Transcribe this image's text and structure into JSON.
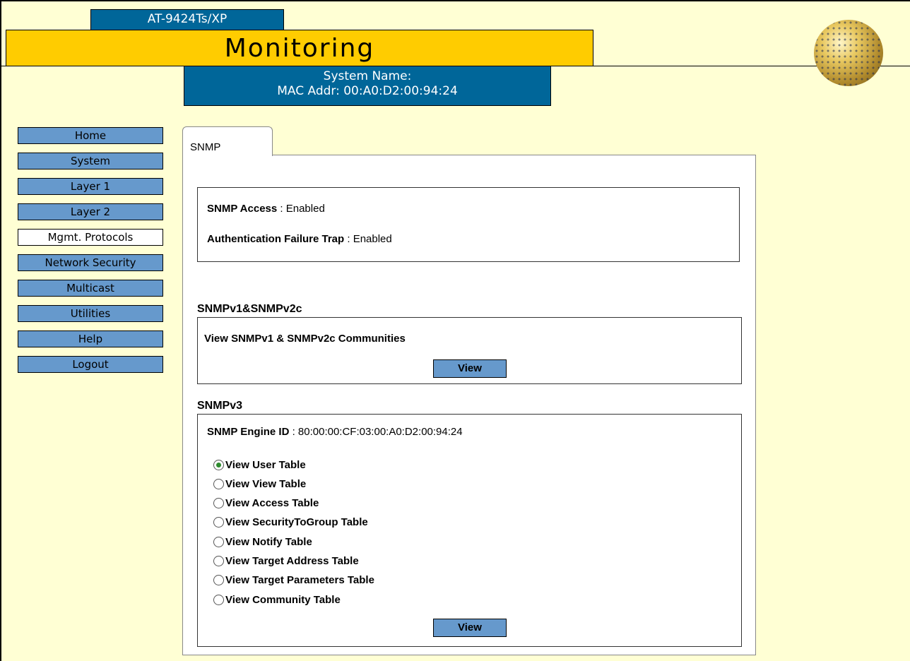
{
  "header": {
    "model": "AT-9424Ts/XP",
    "title": "Monitoring",
    "system_name": "System Name:",
    "mac_addr": "MAC Addr: 00:A0:D2:00:94:24"
  },
  "nav": [
    {
      "label": "Home",
      "active": false
    },
    {
      "label": "System",
      "active": false
    },
    {
      "label": "Layer 1",
      "active": false
    },
    {
      "label": "Layer 2",
      "active": false
    },
    {
      "label": "Mgmt. Protocols",
      "active": true
    },
    {
      "label": "Network Security",
      "active": false
    },
    {
      "label": "Multicast",
      "active": false
    },
    {
      "label": "Utilities",
      "active": false
    },
    {
      "label": "Help",
      "active": false
    },
    {
      "label": "Logout",
      "active": false
    }
  ],
  "tab": {
    "label": "SNMP"
  },
  "status": {
    "access_label": "SNMP Access",
    "access_value": " : Enabled",
    "auth_label": "Authentication Failure Trap",
    "auth_value": " : Enabled"
  },
  "v1v2c": {
    "title": "SNMPv1&SNMPv2c",
    "text": "View SNMPv1 & SNMPv2c Communities",
    "button": "View"
  },
  "v3": {
    "title": "SNMPv3",
    "engine_label": "SNMP Engine ID",
    "engine_value": " : 80:00:00:CF:03:00:A0:D2:00:94:24",
    "options": [
      {
        "label": "View User Table",
        "selected": true
      },
      {
        "label": "View View Table",
        "selected": false
      },
      {
        "label": "View Access Table",
        "selected": false
      },
      {
        "label": "View SecurityToGroup Table",
        "selected": false
      },
      {
        "label": "View Notify Table",
        "selected": false
      },
      {
        "label": "View Target Address Table",
        "selected": false
      },
      {
        "label": "View Target Parameters Table",
        "selected": false
      },
      {
        "label": "View Community Table",
        "selected": false
      }
    ],
    "button": "View"
  },
  "colors": {
    "background": "#ffffd4",
    "header_blue": "#006699",
    "title_yellow": "#ffcc00",
    "nav_blue": "#6699cc"
  }
}
